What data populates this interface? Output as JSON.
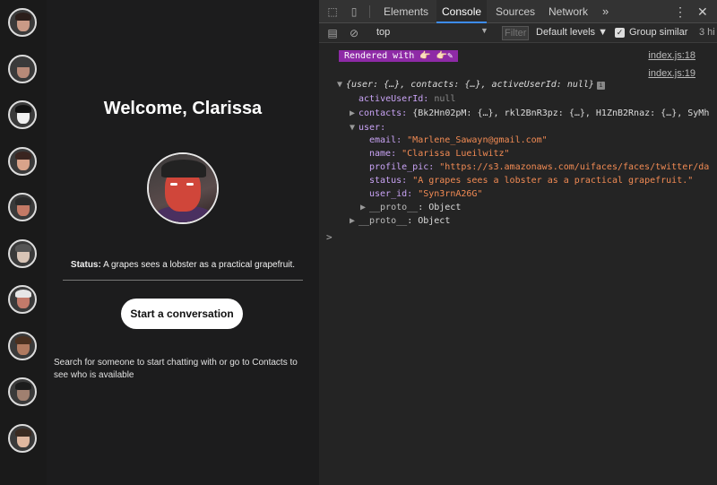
{
  "app": {
    "welcome_title": "Welcome, Clarissa",
    "status_label": "Status:",
    "status_text": "A grapes sees a lobster as a practical grapefruit.",
    "start_button": "Start a conversation",
    "hint": "Search for someone to start chatting with or go to Contacts to see who is available",
    "contacts": [
      {
        "skin": "#c99a86",
        "hair": "#2b1e1a"
      },
      {
        "skin": "#b88a78",
        "hair": "#3a3a3a"
      },
      {
        "skin": "#f0f0f0",
        "hair": "#111111"
      },
      {
        "skin": "#d9a38a",
        "hair": "#3a2520"
      },
      {
        "skin": "#c47a66",
        "hair": "#2a2a2a"
      },
      {
        "skin": "#d8c4b6",
        "hair": "#555555"
      },
      {
        "skin": "#c27a6a",
        "hair": "#e6e6e6"
      },
      {
        "skin": "#b07a60",
        "hair": "#4a3020"
      },
      {
        "skin": "#a08070",
        "hair": "#1c1c1c"
      },
      {
        "skin": "#e0b8a0",
        "hair": "#3a2a20"
      }
    ]
  },
  "devtools": {
    "tabs": {
      "elements": "Elements",
      "console": "Console",
      "sources": "Sources",
      "network": "Network",
      "more": "»"
    },
    "toolbar": {
      "context": "top",
      "filter_placeholder": "Filter",
      "levels": "Default levels ▼",
      "group_similar": "Group similar",
      "hidden_count": "3 hi"
    },
    "console": {
      "rendered_badge": "Rendered with 👉🏻 👉🏻✎",
      "link1": "index.js:18",
      "link2": "index.js:19",
      "object_summary": "{user: {…}, contacts: {…}, activeUserId: null}",
      "active_key": "activeUserId:",
      "active_val": "null",
      "contacts_key": "contacts:",
      "contacts_val": "{Bk2Hn02pM: {…}, rkl2BnR3pz: {…}, H1ZnB2Rnaz: {…}, SyMh",
      "user_key": "user:",
      "email_key": "email:",
      "email_val": "\"Marlene_Sawayn@gmail.com\"",
      "name_key": "name:",
      "name_val": "\"Clarissa Lueilwitz\"",
      "pic_key": "profile_pic:",
      "pic_val": "\"https://s3.amazonaws.com/uifaces/faces/twitter/da",
      "status_key": "status:",
      "status_val": "\"A grapes sees a lobster as a practical grapefruit.\"",
      "uid_key": "user_id:",
      "uid_val": "\"Syn3rnA26G\"",
      "proto_inner_key": "__proto__",
      "proto_inner_val": ": Object",
      "proto_outer_key": "__proto__",
      "proto_outer_val": ": Object",
      "prompt": ">"
    }
  }
}
